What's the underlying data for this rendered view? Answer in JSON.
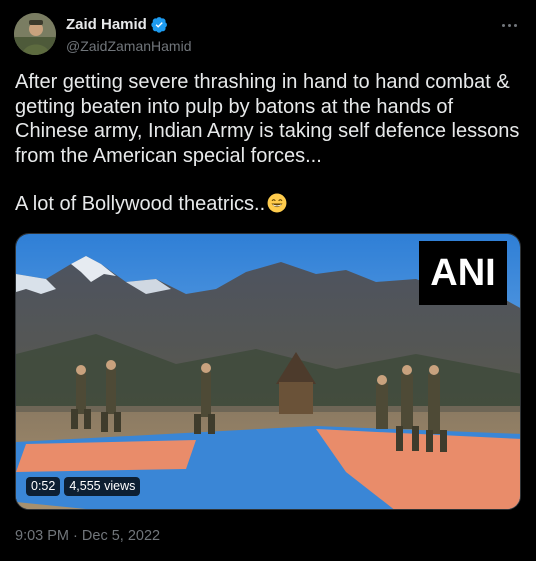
{
  "author": {
    "name": "Zaid Hamid",
    "handle": "@ZaidZamanHamid",
    "verified": true,
    "accent": "#1d9bf0"
  },
  "tweet": {
    "text_p1": "After getting severe thrashing in hand to hand combat & getting beaten into pulp by batons at the hands of Chinese army, Indian Army is taking self defence lessons from the American special forces...",
    "text_p2": "A lot of Bollywood theatrics..",
    "emoji": "grinning-face-with-smiling-eyes"
  },
  "media": {
    "watermark": "ANI",
    "duration": "0:52",
    "views": "4,555 views"
  },
  "timestamp": {
    "time": "9:03 PM",
    "separator": "·",
    "date": "Dec 5, 2022"
  },
  "icons": {
    "more": "more-dots-icon",
    "verified": "verified-badge-icon"
  }
}
